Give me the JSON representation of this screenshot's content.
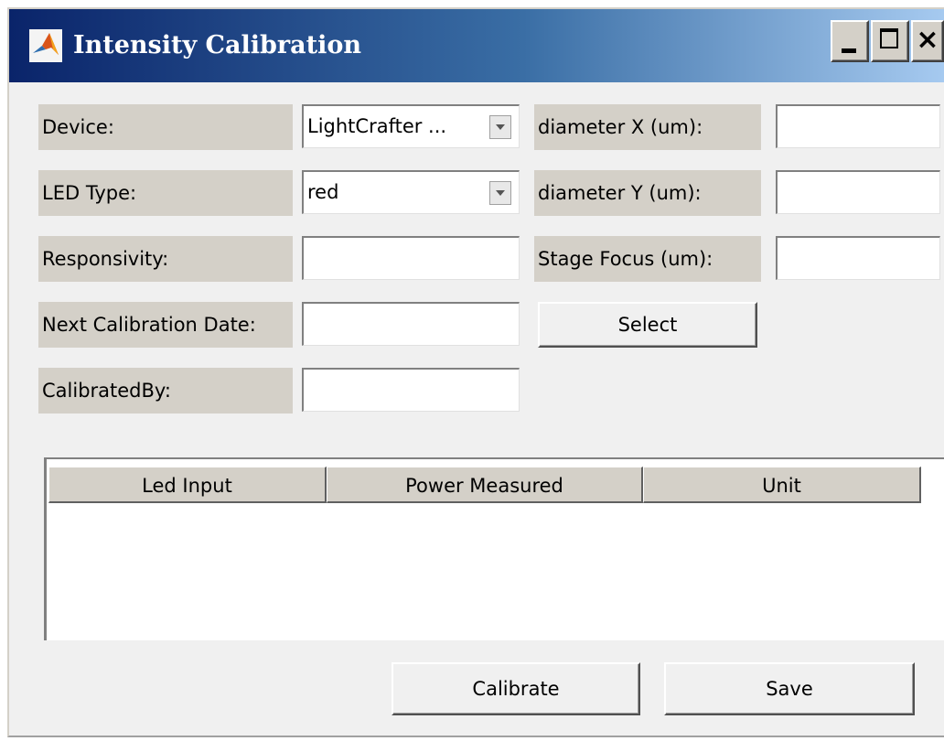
{
  "window": {
    "title": "Intensity Calibration",
    "icon": "matlab-logo-icon",
    "controls": {
      "minimize": "minimize-icon",
      "maximize": "maximize-icon",
      "close": "×"
    }
  },
  "form": {
    "device_label": "Device:",
    "device_value": "LightCrafter ...",
    "led_type_label": "LED Type:",
    "led_type_value": "red",
    "responsivity_label": "Responsivity:",
    "responsivity_value": "",
    "next_calibration_label": "Next Calibration Date:",
    "next_calibration_value": "",
    "calibrated_by_label": "CalibratedBy:",
    "calibrated_by_value": "",
    "diameter_x_label": "diameter X (um):",
    "diameter_x_value": "",
    "diameter_y_label": "diameter Y (um):",
    "diameter_y_value": "",
    "stage_focus_label": "Stage Focus (um):",
    "stage_focus_value": "",
    "select_button": "Select"
  },
  "table": {
    "columns": [
      "Led Input",
      "Power Measured",
      "Unit"
    ],
    "rows": []
  },
  "actions": {
    "calibrate": "Calibrate",
    "save": "Save"
  },
  "colors": {
    "titlebar_start": "#0a246a",
    "titlebar_end": "#a6caf0",
    "panel": "#f0f0f0",
    "label_bg": "#d4d0c8"
  }
}
